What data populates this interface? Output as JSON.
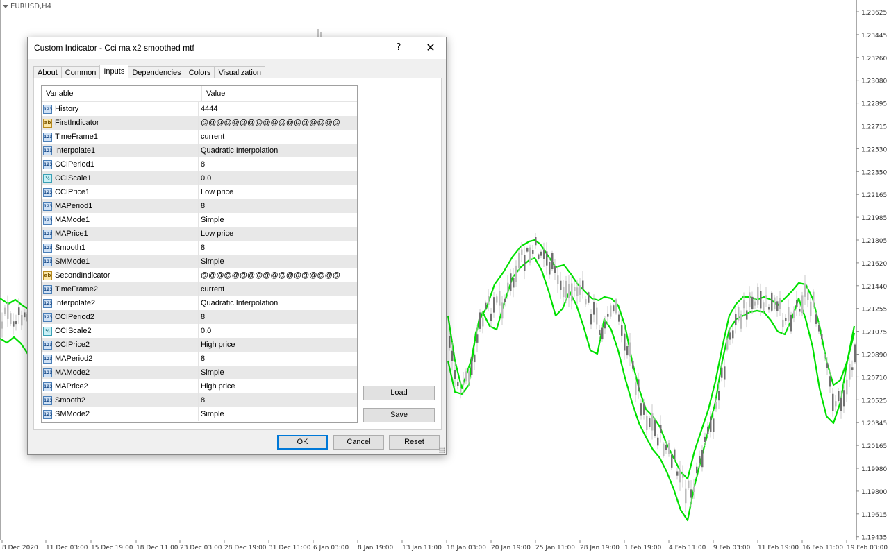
{
  "chart": {
    "symbol": "EURUSD,H4",
    "price_axis": [
      "1.23625",
      "1.23445",
      "1.23260",
      "1.23080",
      "1.22895",
      "1.22715",
      "1.22530",
      "1.22350",
      "1.22165",
      "1.21985",
      "1.21805",
      "1.21620",
      "1.21440",
      "1.21255",
      "1.21075",
      "1.20890",
      "1.20710",
      "1.20525",
      "1.20345",
      "1.20165",
      "1.19980",
      "1.19800",
      "1.19615",
      "1.19435"
    ],
    "time_axis": [
      "8 Dec 2020",
      "11 Dec 03:00",
      "15 Dec 19:00",
      "18 Dec 11:00",
      "23 Dec 03:00",
      "28 Dec 19:00",
      "31 Dec 11:00",
      "6 Jan 03:00",
      "8 Jan 19:00",
      "13 Jan 11:00",
      "18 Jan 03:00",
      "20 Jan 19:00",
      "25 Jan 11:00",
      "28 Jan 19:00",
      "1 Feb 19:00",
      "4 Feb 11:00",
      "9 Feb 03:00",
      "11 Feb 19:00",
      "16 Feb 11:00",
      "19 Feb 03:00"
    ],
    "line_color": "#00e000",
    "candle_up_color": "#bdbdbd",
    "candle_down_color": "#707070"
  },
  "dialog": {
    "title": "Custom Indicator - Cci ma x2 smoothed mtf",
    "help_label": "?",
    "close_label": "✕",
    "tabs": [
      "About",
      "Common",
      "Inputs",
      "Dependencies",
      "Colors",
      "Visualization"
    ],
    "active_tab": "Inputs",
    "columns": {
      "variable": "Variable",
      "value": "Value"
    },
    "rows": [
      {
        "type": "int",
        "var": "History",
        "val": "4444"
      },
      {
        "type": "string",
        "var": "FirstIndicator",
        "val": "@@@@@@@@@@@@@@@@@@"
      },
      {
        "type": "int",
        "var": "TimeFrame1",
        "val": "current"
      },
      {
        "type": "int",
        "var": "Interpolate1",
        "val": "Quadratic Interpolation"
      },
      {
        "type": "int",
        "var": "CCIPeriod1",
        "val": "8"
      },
      {
        "type": "double",
        "var": "CCIScale1",
        "val": "0.0"
      },
      {
        "type": "int",
        "var": "CCIPrice1",
        "val": "Low price"
      },
      {
        "type": "int",
        "var": "MAPeriod1",
        "val": "8"
      },
      {
        "type": "int",
        "var": "MAMode1",
        "val": "Simple"
      },
      {
        "type": "int",
        "var": "MAPrice1",
        "val": "Low price"
      },
      {
        "type": "int",
        "var": "Smooth1",
        "val": "8"
      },
      {
        "type": "int",
        "var": "SMMode1",
        "val": "Simple"
      },
      {
        "type": "string",
        "var": "SecondIndicator",
        "val": "@@@@@@@@@@@@@@@@@@"
      },
      {
        "type": "int",
        "var": "TimeFrame2",
        "val": "current"
      },
      {
        "type": "int",
        "var": "Interpolate2",
        "val": "Quadratic Interpolation"
      },
      {
        "type": "int",
        "var": "CCIPeriod2",
        "val": "8"
      },
      {
        "type": "double",
        "var": "CCIScale2",
        "val": "0.0"
      },
      {
        "type": "int",
        "var": "CCIPrice2",
        "val": "High price"
      },
      {
        "type": "int",
        "var": "MAPeriod2",
        "val": "8"
      },
      {
        "type": "int",
        "var": "MAMode2",
        "val": "Simple"
      },
      {
        "type": "int",
        "var": "MAPrice2",
        "val": "High price"
      },
      {
        "type": "int",
        "var": "Smooth2",
        "val": "8"
      },
      {
        "type": "int",
        "var": "SMMode2",
        "val": "Simple"
      }
    ],
    "icon_text": {
      "int": "123",
      "string": "ab",
      "double": "½"
    },
    "buttons": {
      "load": "Load",
      "save": "Save",
      "ok": "OK",
      "cancel": "Cancel",
      "reset": "Reset"
    }
  }
}
